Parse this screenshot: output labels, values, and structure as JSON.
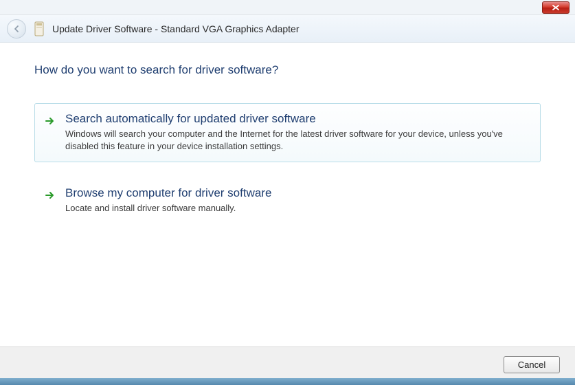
{
  "window": {
    "title": "Update Driver Software - Standard VGA Graphics Adapter"
  },
  "heading": "How do you want to search for driver software?",
  "options": [
    {
      "title": "Search automatically for updated driver software",
      "description": "Windows will search your computer and the Internet for the latest driver software for your device, unless you've disabled this feature in your device installation settings."
    },
    {
      "title": "Browse my computer for driver software",
      "description": "Locate and install driver software manually."
    }
  ],
  "footer": {
    "cancel_label": "Cancel"
  }
}
